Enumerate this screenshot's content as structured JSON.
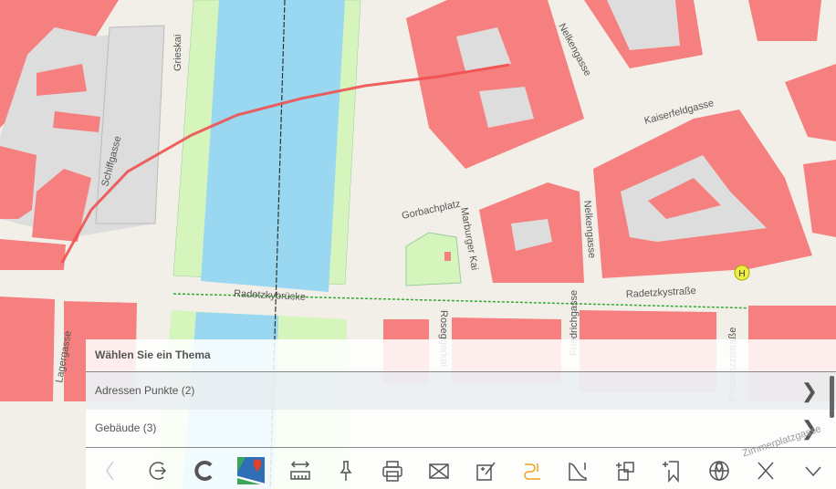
{
  "map": {
    "streets": [
      "Grieskai",
      "Schiffgasse",
      "Nelkengasse",
      "Nelkengasse",
      "Kaiserfeldgasse",
      "Gorbachplatz",
      "Marburger Kai",
      "Radetzkybrücke",
      "Radetzkystraße",
      "Lagergasse",
      "Roseggerkai",
      "Friedrichgasse",
      "Pestalozzistraße",
      "Zimmerplatzgasse"
    ],
    "bus_stop_label": "H",
    "colors": {
      "building": "#f67f7f",
      "land": "#f2efe9",
      "water": "#99d8f0",
      "green": "#d6f5bd",
      "measure": "#f05050"
    }
  },
  "panel": {
    "title": "Wählen Sie ein Thema",
    "items": [
      {
        "label": "Adressen Punkte (2)"
      },
      {
        "label": "Gebäude (3)"
      }
    ]
  },
  "toolbar": [
    "back-icon",
    "login-icon",
    "refresh-icon",
    "google-maps-icon",
    "measure-icon",
    "pin-icon",
    "print-icon",
    "mail-icon",
    "edit-icon",
    "path-info-icon",
    "area-info-icon",
    "copy-add-icon",
    "bookmark-add-icon",
    "geolocate-icon",
    "close-icon",
    "collapse-icon"
  ]
}
